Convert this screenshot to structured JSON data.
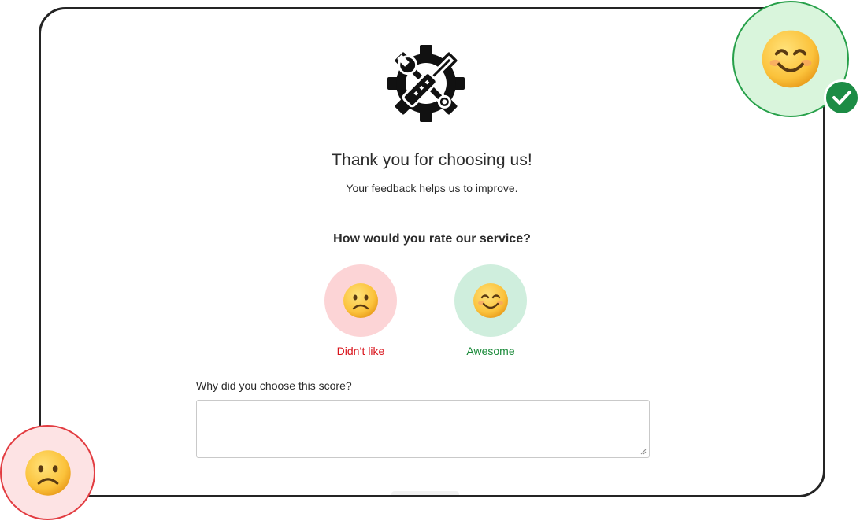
{
  "logo": {
    "icon": "gear-wrench-screwdriver-icon",
    "color": "#111111"
  },
  "header": {
    "title": "Thank you for choosing us!",
    "subtitle": "Your feedback helps us to improve."
  },
  "rating": {
    "question": "How would you rate our service?",
    "options": [
      {
        "label": "Didn’t like",
        "icon": "frowning-face-icon",
        "color": "#d9141c",
        "background": "#fcd4d6"
      },
      {
        "label": "Awesome",
        "icon": "smiling-face-icon",
        "color": "#1a8a3a",
        "background": "#cfeedd"
      }
    ]
  },
  "reason": {
    "label": "Why did you choose this score?",
    "value": "",
    "placeholder": ""
  },
  "decorations": {
    "happy_badge": {
      "icon": "smiling-face-icon",
      "check_icon": "checkmark-icon",
      "accent": "#1c8c45"
    },
    "sad_badge": {
      "icon": "frowning-face-icon",
      "accent": "#e23c41"
    }
  }
}
